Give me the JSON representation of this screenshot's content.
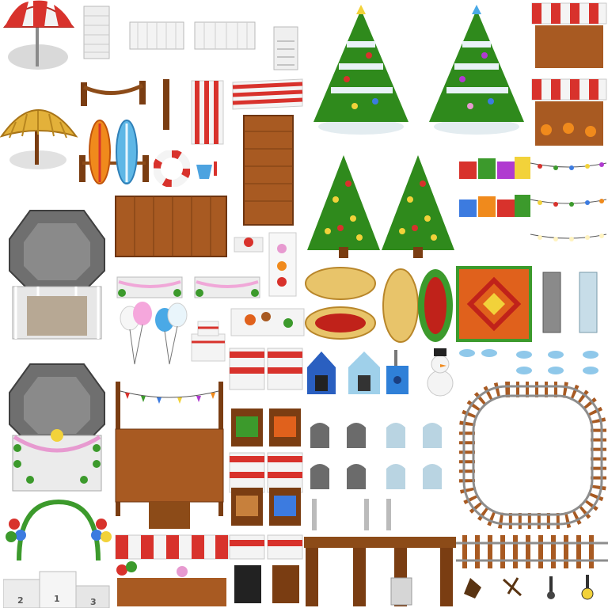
{
  "tileset": {
    "background": "#ffffff",
    "colors": {
      "stripe_red": "#d8322c",
      "stripe_white": "#f4f4f4",
      "wood_dark": "#7a3d12",
      "wood_mid": "#a85a22",
      "wood_light": "#c7803c",
      "stone_gray": "#6b6b6b",
      "tree_green": "#2f8a1c",
      "snow_white": "#e9f2f7",
      "carpet_red": "#c0221a",
      "carpet_orange": "#e0611c",
      "rail_steel": "#8d8d8d"
    },
    "podium_labels": [
      "2",
      "1",
      "3"
    ],
    "icons": [
      "beach-umbrella-icon",
      "straw-umbrella-icon",
      "deck-chair-icon",
      "white-fence-icon",
      "rope-fence-icon",
      "surfboard-icon",
      "life-ring-icon",
      "sand-bucket-icon",
      "beach-towel-icon",
      "wooden-pier-icon",
      "gazebo-icon",
      "decorated-gazebo-icon",
      "balloon-arch-icon",
      "podium-icon",
      "christmas-tree-icon",
      "snowy-christmas-tree-icon",
      "market-stall-icon",
      "gift-boxes-icon",
      "string-lights-icon",
      "oval-rug-icon",
      "square-carpet-icon",
      "stone-pillar-icon",
      "dog-house-icon",
      "birdhouse-icon",
      "snowman-icon",
      "tombstone-icon",
      "rail-track-icon",
      "lamp-icon"
    ]
  }
}
